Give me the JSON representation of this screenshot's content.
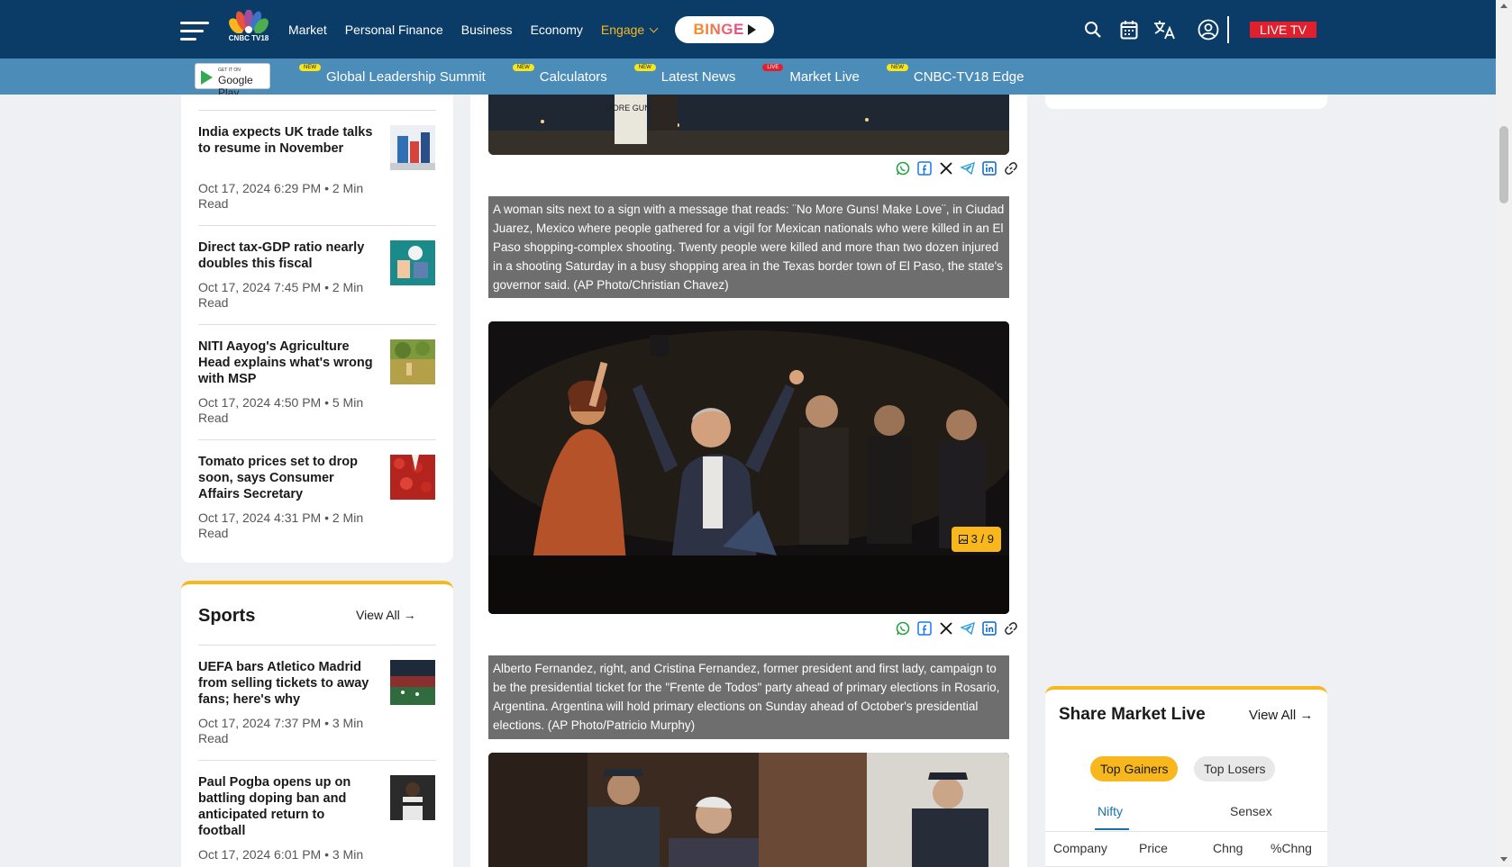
{
  "header": {
    "logo_text": "CNBC TV18",
    "nav": [
      "Market",
      "Personal Finance",
      "Business",
      "Economy"
    ],
    "engage_label": "Engage",
    "binge_label": "BINGE",
    "live_tv_label": "LIVE TV"
  },
  "subnav": {
    "google_play_small": "GET IT ON",
    "google_play_big": "Google Play",
    "items": [
      {
        "badge": "NEW",
        "label": "Global Leadership Summit"
      },
      {
        "badge": "NEW",
        "label": "Calculators"
      },
      {
        "badge": "NEW",
        "label": "Latest News"
      },
      {
        "badge": "LIVE",
        "label": "Market Live"
      },
      {
        "badge": "NEW",
        "label": "CNBC-TV18 Edge"
      }
    ]
  },
  "left_stories": [
    {
      "title": "India expects UK trade talks to resume in November",
      "meta": "Oct 17, 2024 6:29 PM • 2 Min Read"
    },
    {
      "title": "Direct tax-GDP ratio nearly doubles this fiscal",
      "meta": "Oct 17, 2024 7:45 PM • 2 Min Read"
    },
    {
      "title": "NITI Aayog's Agriculture Head explains what's wrong with MSP",
      "meta": "Oct 17, 2024 4:50 PM • 5 Min Read"
    },
    {
      "title": "Tomato prices set to drop soon, says Consumer Affairs Secretary",
      "meta": "Oct 17, 2024 4:31 PM • 2 Min Read"
    }
  ],
  "sports": {
    "title": "Sports",
    "view_all": "View All →",
    "stories": [
      {
        "title": "UEFA bars Atletico Madrid from selling tickets to away fans; here's why",
        "meta": "Oct 17, 2024 7:37 PM • 3 Min Read"
      },
      {
        "title": "Paul Pogba opens up on battling doping ban and anticipated return to football",
        "meta": "Oct 17, 2024 6:01 PM • 3 Min"
      }
    ]
  },
  "gallery": {
    "sign_text": "MORE GUNS",
    "caption1": "A woman sits next to a sign with a message that reads: ¨No More Guns! Make Love¨, in Ciudad Juarez, Mexico where people gathered for a vigil for Mexican nationals who were killed in an El Paso shopping-complex shooting. Twenty people were killed and more than two dozen injured in a shooting Saturday in a busy shopping area in the Texas border town of El Paso, the state's governor said. (AP Photo/Christian Chavez)",
    "counter": "3 / 9",
    "caption2": "Alberto Fernandez, right, and Cristina Fernandez, former president and first lady, campaign to be the presidential ticket for the \"Frente de Todos\" party ahead of primary elections in Rosario, Argentina. Argentina will hold primary elections on Sunday ahead of October's presidential elections. (AP Photo/Patricio Murphy)"
  },
  "market": {
    "title": "Share Market Live",
    "view_all": "View All →",
    "tab_on": "Top Gainers",
    "tab_off": "Top Losers",
    "index_on": "Nifty",
    "index_off": "Sensex",
    "columns": [
      "Company",
      "Price",
      "Chng",
      "%Chng"
    ]
  },
  "colors": {
    "header_bg": "#0b3c68",
    "subbar_bg": "#4b8db8",
    "accent": "#f7b71d",
    "live_red": "#e0202d",
    "caption_bg": "#6e6e6e"
  },
  "icons": [
    "menu-icon",
    "search-icon",
    "calendar-icon",
    "translate-icon",
    "user-icon",
    "whatsapp-icon",
    "facebook-icon",
    "x-icon",
    "telegram-icon",
    "linkedin-icon",
    "link-icon",
    "image-icon"
  ]
}
